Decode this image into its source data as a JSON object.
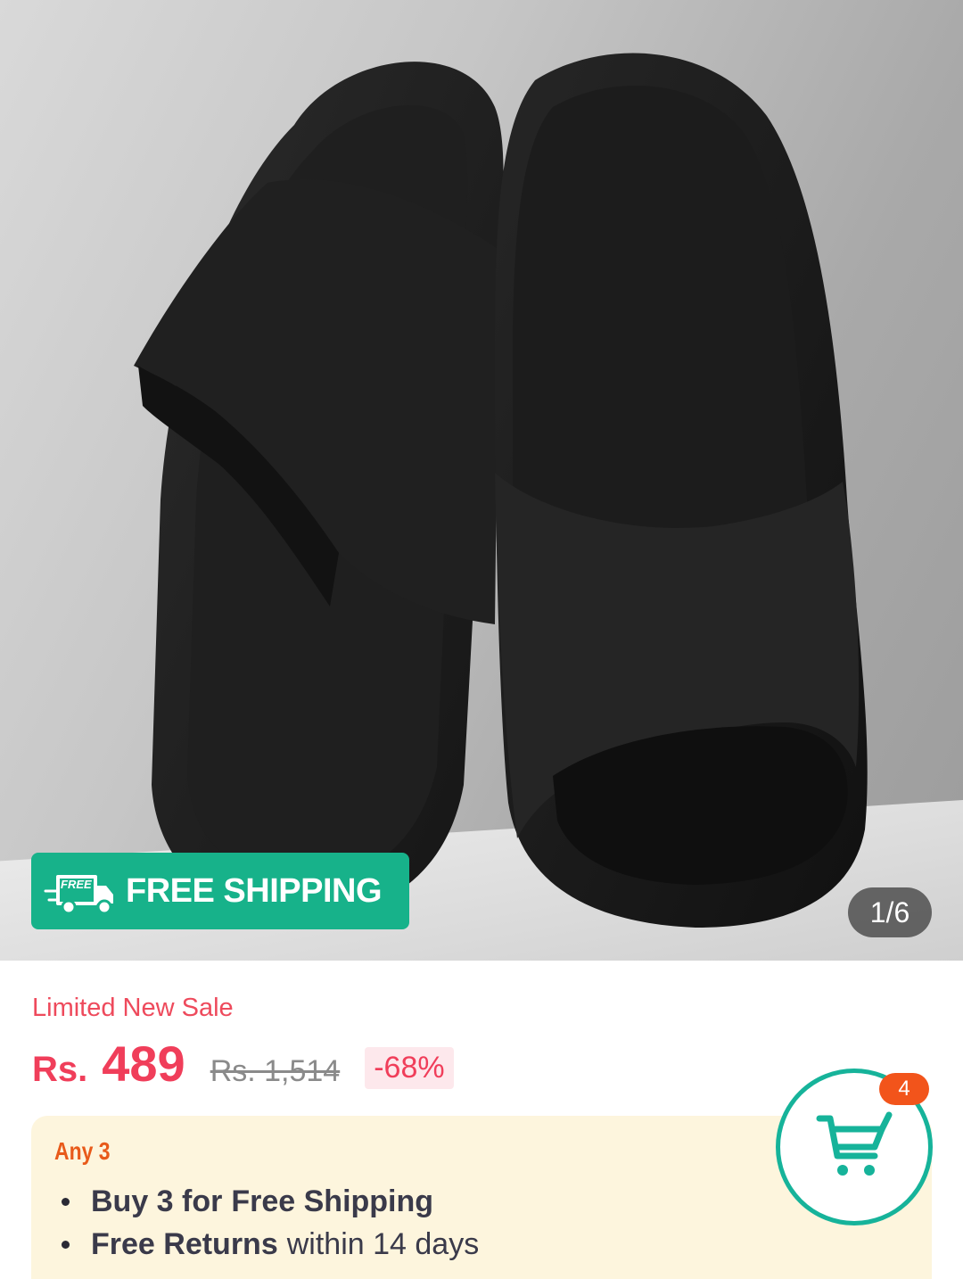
{
  "product_image": {
    "alt": "Black textured slide sandals",
    "counter": "1/6"
  },
  "shipping_badge": {
    "icon_text": "FREE",
    "label": "FREE SHIPPING",
    "color": "#17b28a"
  },
  "pricing": {
    "sale_tag": "Limited New Sale",
    "currency": "Rs.",
    "price": "489",
    "original_price": "Rs. 1,514",
    "discount": "-68%",
    "accent_color": "#f03e5a"
  },
  "promo": {
    "title": "Any 3",
    "items": [
      {
        "bold": "Buy 3 for",
        "bold2": "Free Shipping",
        "rest": ""
      },
      {
        "bold": "Free Returns",
        "bold2": "",
        "rest": "within 14 days"
      }
    ]
  },
  "cart": {
    "icon": "cart-icon",
    "badge_count": "4",
    "ring_color": "#16b39a",
    "badge_color": "#f2541b"
  }
}
